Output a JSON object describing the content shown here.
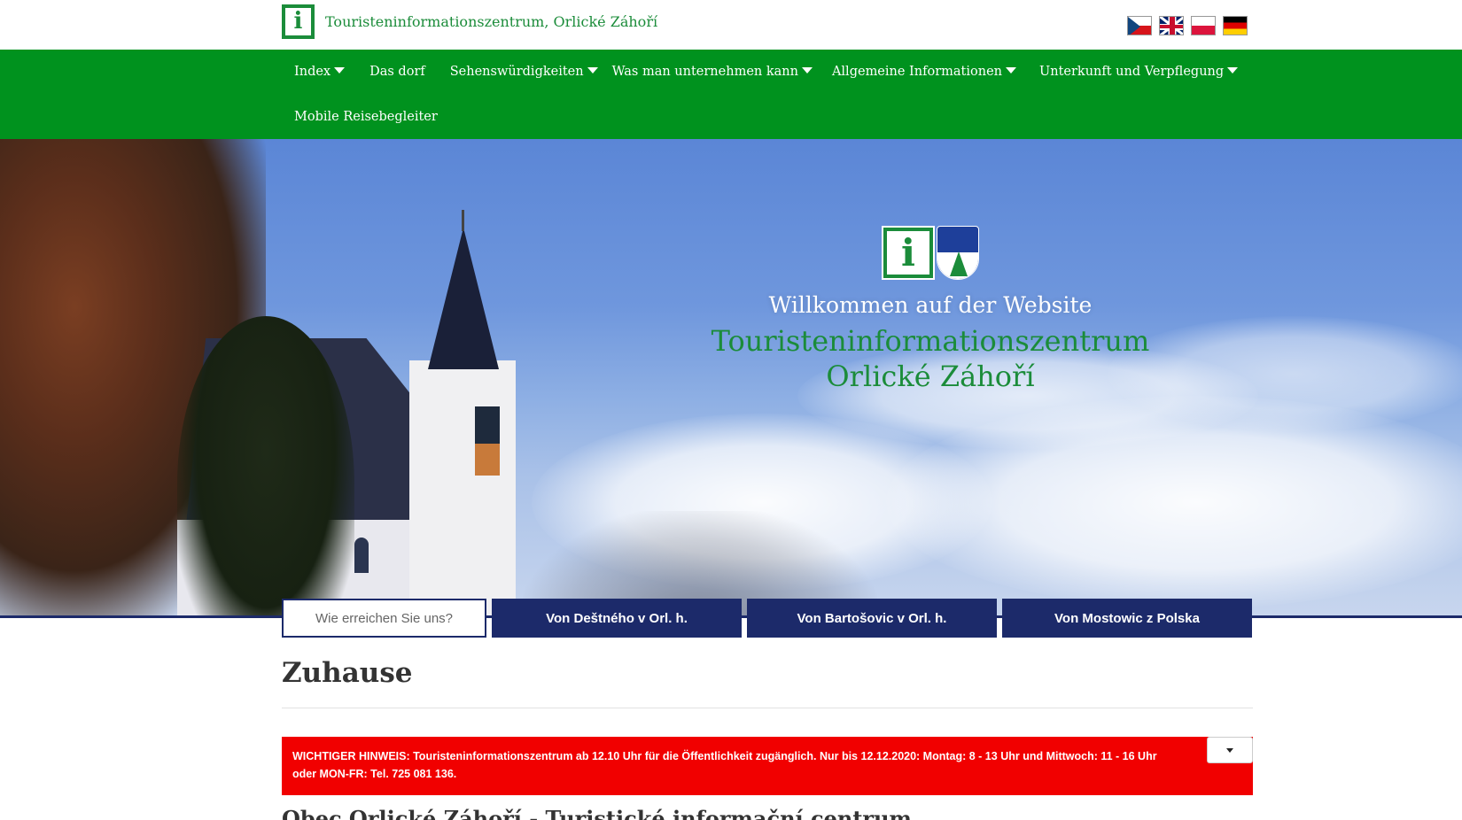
{
  "header": {
    "site_title": "Touristeninformationszentrum, Orlické Záhoří",
    "logo_letter": "i",
    "languages": [
      "cz-flag-icon",
      "gb-flag-icon",
      "pl-flag-icon",
      "de-flag-icon"
    ]
  },
  "nav": {
    "items": [
      {
        "label": "Index",
        "dropdown": true
      },
      {
        "label": "Das dorf",
        "dropdown": false
      },
      {
        "label": "Sehenswürdigkeiten",
        "dropdown": true
      },
      {
        "label": "Was man unternehmen kann",
        "dropdown": true
      },
      {
        "label": "Allgemeine Informationen",
        "dropdown": true
      },
      {
        "label": "Unterkunft und Verpflegung",
        "dropdown": true
      },
      {
        "label": "Mobile Reisebegleiter",
        "dropdown": false
      }
    ]
  },
  "hero": {
    "welcome": "Willkommen auf der Website",
    "title_line1": "Touristeninformationszentrum",
    "title_line2": "Orlické Záhoří",
    "buttons": [
      "Wie erreichen Sie uns?",
      "Von Deštného v Orl. h.",
      "Von Bartošovic v Orl. h.",
      "Von Mostowic z Polska"
    ]
  },
  "main": {
    "page_title": "Zuhause",
    "notice": "WICHTIGER HINWEIS: Touristeninformationszentrum ab 12.10 Uhr für die Öffentlichkeit zugänglich. Nur bis 12.12.2020: Montag: 8 - 13 Uhr und Mittwoch: 11 - 16 Uhr oder MON-FR: Tel. 725 081 136.",
    "subheading": "Obec Orlické Záhoří - Turistické informační centrum"
  },
  "colors": {
    "nav_green": "#00921e",
    "brand_green": "#1b8c3a",
    "button_navy": "#1c2a6a",
    "notice_red": "#f10000"
  }
}
